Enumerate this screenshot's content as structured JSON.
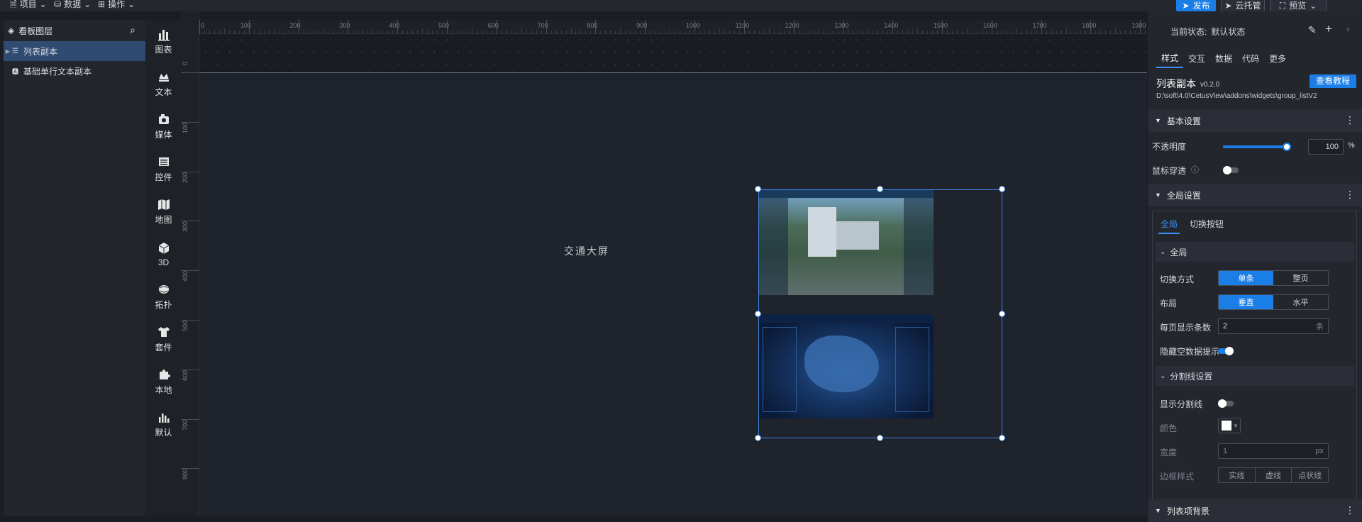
{
  "menu": {
    "project": "项目",
    "data": "数据",
    "operate": "操作"
  },
  "top_actions": {
    "publish": "发布",
    "cloud_host": "云托管",
    "preview": "预览"
  },
  "layers": {
    "title": "看板图层",
    "items": [
      {
        "label": "列表副本",
        "selected": true
      },
      {
        "label": "基础单行文本副本",
        "selected": false
      }
    ]
  },
  "toolbox": [
    {
      "label": "图表",
      "icon": "chart-icon"
    },
    {
      "label": "文本",
      "icon": "text-icon"
    },
    {
      "label": "媒体",
      "icon": "media-icon"
    },
    {
      "label": "控件",
      "icon": "widget-icon"
    },
    {
      "label": "地图",
      "icon": "map-icon"
    },
    {
      "label": "3D",
      "icon": "cube-icon"
    },
    {
      "label": "拓扑",
      "icon": "topology-icon"
    },
    {
      "label": "套件",
      "icon": "shirt-icon"
    },
    {
      "label": "本地",
      "icon": "puzzle-icon"
    },
    {
      "label": "默认",
      "icon": "default-chart-icon"
    }
  ],
  "ruler": {
    "h_ticks": [
      "0",
      "100",
      "200",
      "300",
      "400",
      "500",
      "600",
      "700",
      "800",
      "900",
      "1000",
      "1100",
      "1200",
      "1300",
      "1400",
      "1500",
      "1600",
      "1700",
      "1800",
      "1900"
    ],
    "v_ticks": [
      "0",
      "100",
      "200",
      "300",
      "400",
      "500",
      "600",
      "700",
      "800"
    ]
  },
  "canvas": {
    "title": "交通大屏"
  },
  "right_panel": {
    "current_state_label": "当前状态:",
    "current_state_value": "默认状态",
    "tabs": [
      "样式",
      "交互",
      "数据",
      "代码",
      "更多"
    ],
    "active_tab": "样式",
    "widget_name": "列表副本",
    "widget_version": "v0.2.0",
    "tutorial_button": "查看教程",
    "widget_path": "D:\\soft\\4.0\\CetusView\\addons\\widgets\\group_listV2",
    "basic_settings": {
      "title": "基本设置",
      "opacity_label": "不透明度",
      "opacity_value": "100",
      "opacity_unit": "%",
      "opacity_level": 1.0,
      "mouse_through_label": "鼠标穿透"
    },
    "global_settings": {
      "title": "全局设置",
      "subtabs": [
        "全局",
        "切换按钮"
      ],
      "active_subtab": "全局",
      "group_title": "全局",
      "switch_mode_label": "切换方式",
      "switch_mode_options": [
        "单条",
        "整页"
      ],
      "switch_mode_selected": "单条",
      "layout_label": "布局",
      "layout_options": [
        "垂直",
        "水平"
      ],
      "layout_selected": "垂直",
      "per_page_label": "每页显示条数",
      "per_page_value": "2",
      "per_page_unit": "条",
      "hide_empty_label": "隐藏空数据提示",
      "hide_empty_on": true
    },
    "divider_settings": {
      "title": "分割线设置",
      "show_label": "显示分割线",
      "show_on": false,
      "color_label": "颜色",
      "width_label": "宽度",
      "width_value": "1",
      "width_unit": "px",
      "border_style_label": "边框样式",
      "border_style_options": [
        "实线",
        "虚线",
        "点状线"
      ]
    },
    "list_bg_title": "列表项背景"
  },
  "colors": {
    "accent": "#1a7ee6",
    "panel": "#23262d",
    "canvas": "#1f232b"
  }
}
